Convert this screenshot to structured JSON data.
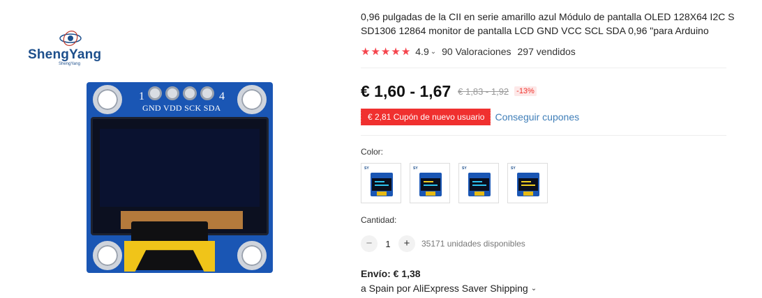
{
  "brand": {
    "name": "ShengYang",
    "sub": "ShengYang"
  },
  "product_image": {
    "pin_numbers": [
      "1",
      "4"
    ],
    "pin_labels": "GND VDD SCK SDA"
  },
  "product": {
    "title": "0,96 pulgadas de la CII en serie amarillo azul Módulo de pantalla OLED 128X64 I2C S SD1306 12864 monitor de pantalla LCD GND VCC SCL SDA 0,96 \"para Arduino",
    "rating_value": "4.9",
    "rating_stars_filled": 5,
    "reviews": "90 Valoraciones",
    "sold": "297 vendidos"
  },
  "price": {
    "current": "€ 1,60 - 1,67",
    "original": "€ 1,83 - 1,92",
    "discount": "-13%"
  },
  "coupon": {
    "tag": "€ 2,81 Cupón de nuevo usuario",
    "link": "Conseguir cupones"
  },
  "color": {
    "label": "Color:",
    "options": [
      {
        "name": "swatch-1",
        "line1": "#2ec4f0",
        "line2": "#2ec4f0"
      },
      {
        "name": "swatch-2",
        "line1": "#f2d021",
        "line2": "#2ec4f0"
      },
      {
        "name": "swatch-3",
        "line1": "#2ec4f0",
        "line2": "#2ec4f0"
      },
      {
        "name": "swatch-4",
        "line1": "#f2d021",
        "line2": "#f2d021"
      }
    ]
  },
  "quantity": {
    "label": "Cantidad:",
    "minus": "−",
    "value": "1",
    "plus": "+",
    "available": "35171 unidades disponibles"
  },
  "shipping": {
    "price": "Envío: € 1,38",
    "destination": "a Spain por AliExpress Saver Shipping"
  },
  "colors": {
    "accent": "#f0302f",
    "link": "#3f7eb8",
    "pcb": "#1a56b4"
  }
}
